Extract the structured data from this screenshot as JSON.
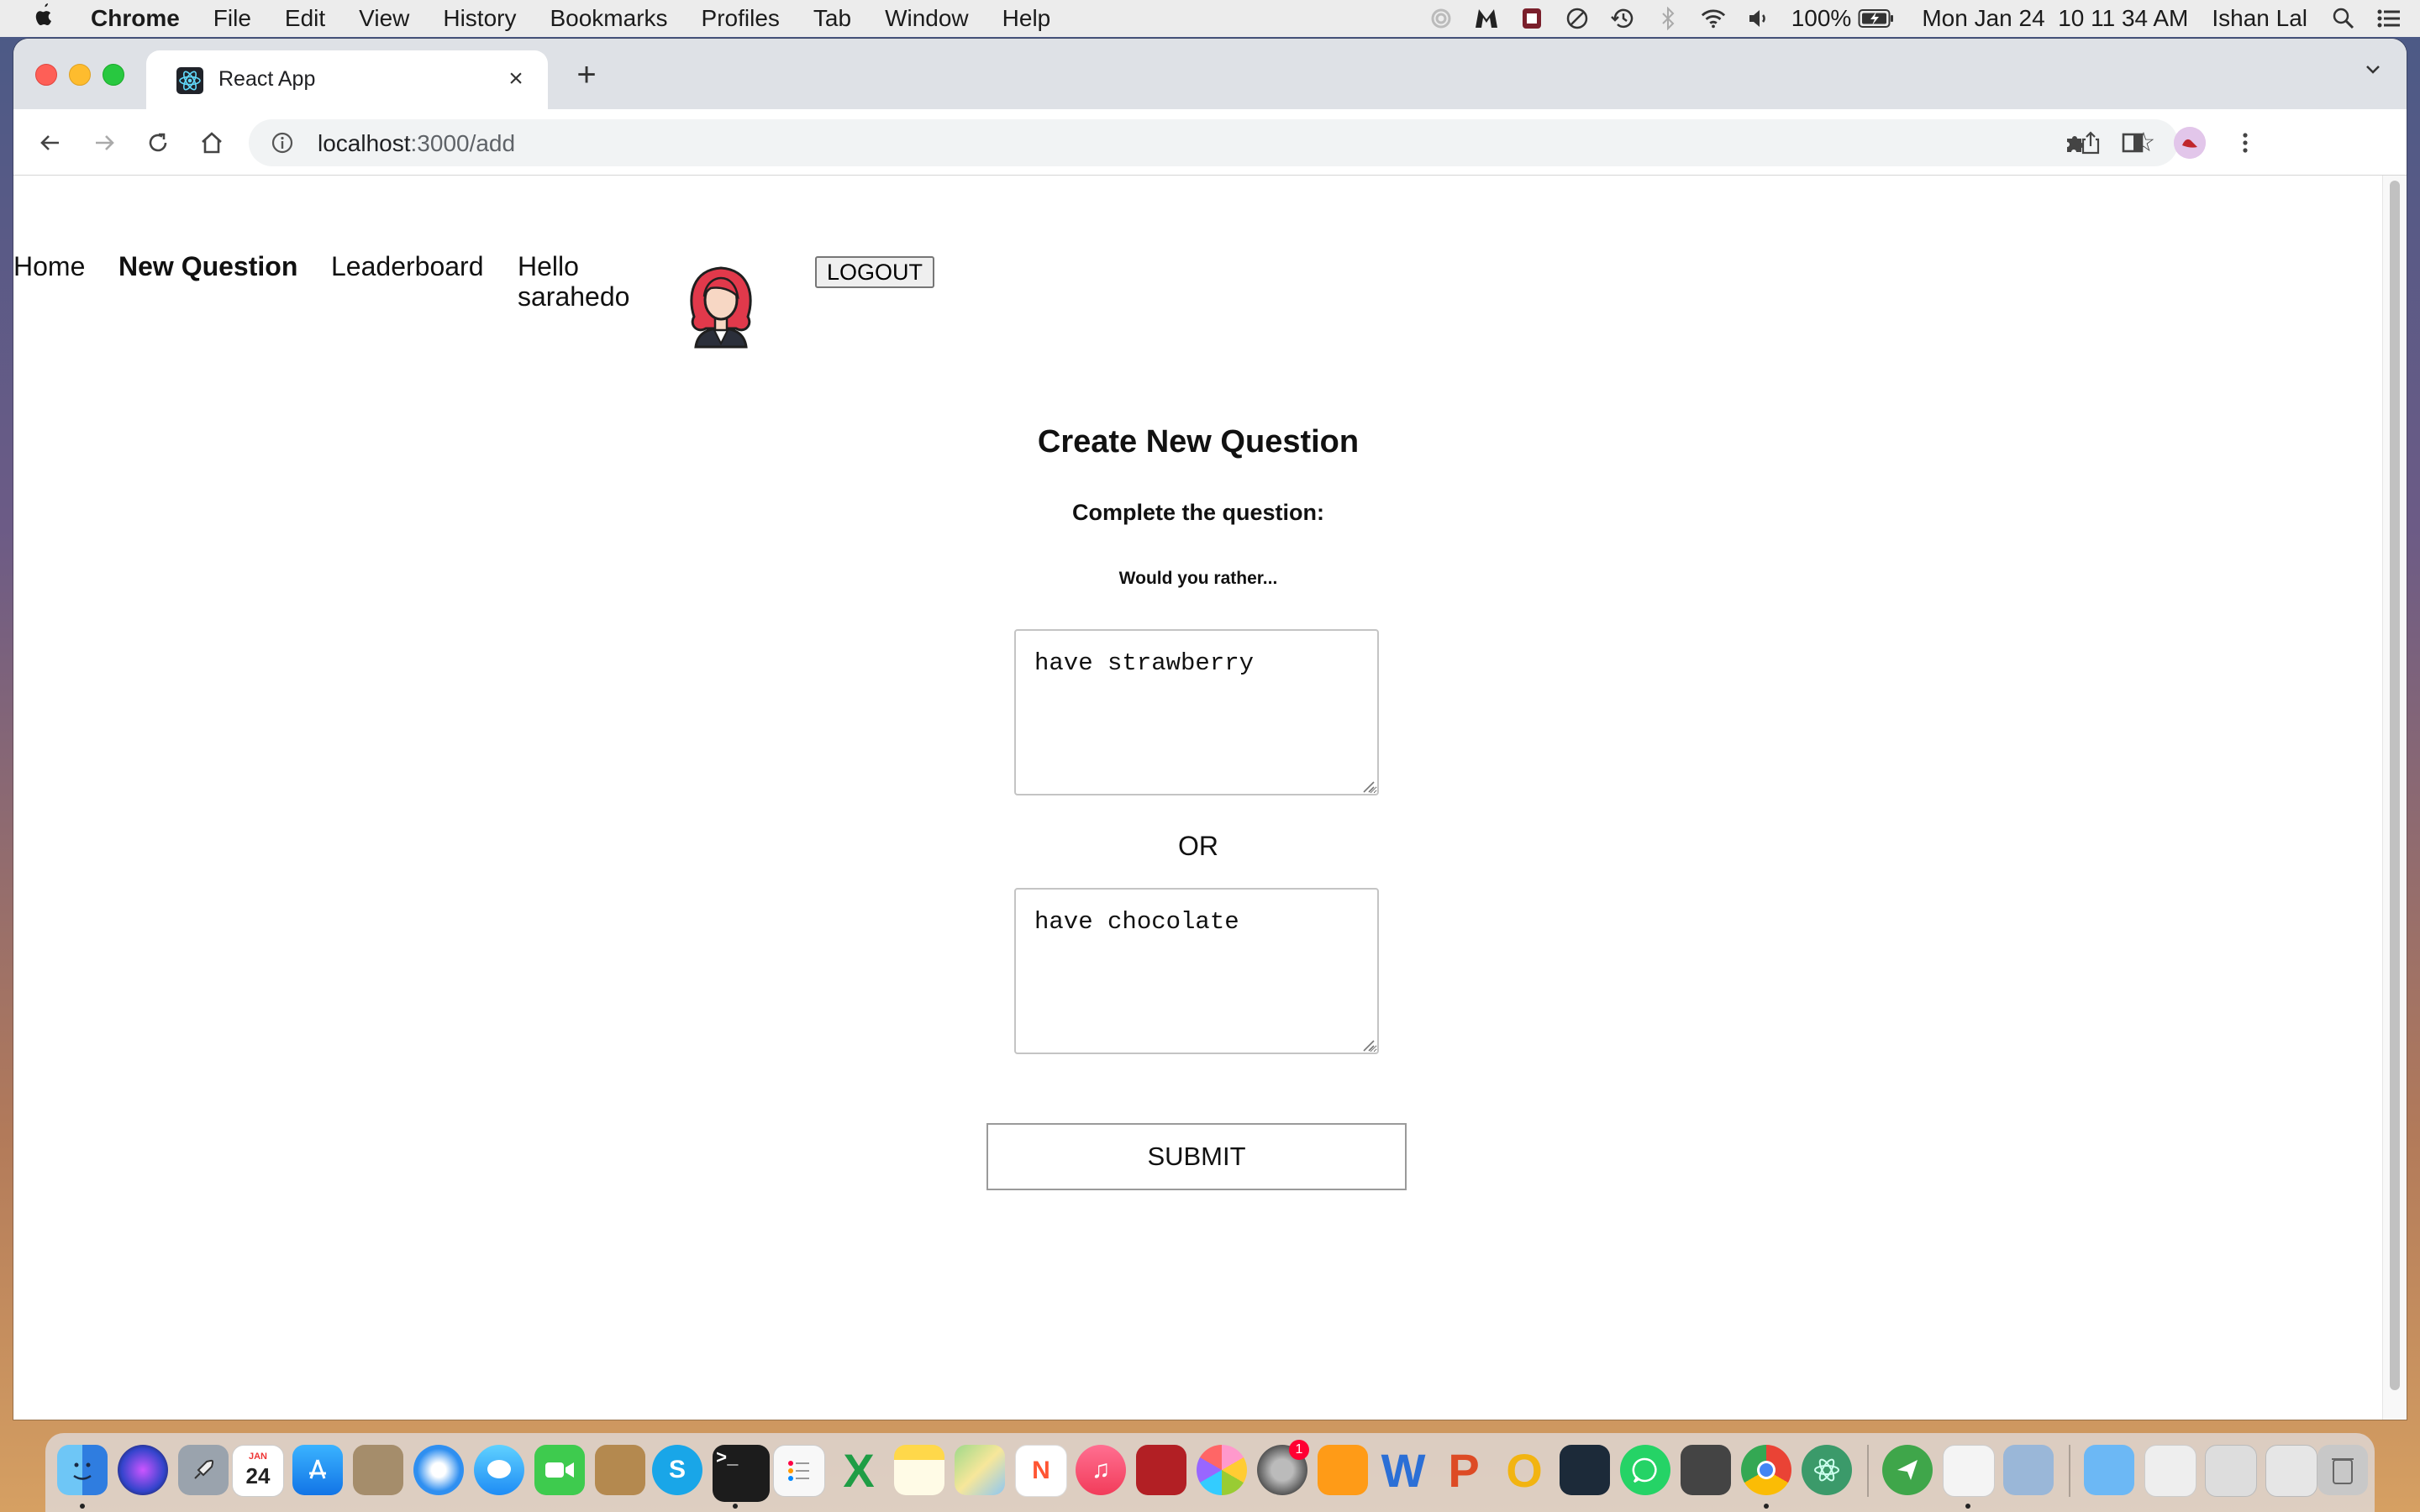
{
  "menubar": {
    "app_name": "Chrome",
    "menus": [
      "File",
      "Edit",
      "View",
      "History",
      "Bookmarks",
      "Profiles",
      "Tab",
      "Window",
      "Help"
    ],
    "status": {
      "battery_percent": "100%",
      "datetime": "Mon Jan 24  10 11 34 AM",
      "user": "Ishan Lal"
    },
    "status_icons": [
      "creative-cloud-icon",
      "malwarebytes-icon",
      "ublock-icon",
      "do-not-disturb-icon",
      "time-machine-icon",
      "bluetooth-icon",
      "wifi-icon",
      "volume-icon",
      "battery-icon",
      "spotlight-search-icon",
      "control-center-icon"
    ]
  },
  "browser": {
    "tab_title": "React App",
    "url_host": "localhost",
    "url_path": ":3000/add"
  },
  "nav": {
    "home": "Home",
    "new_question": "New Question",
    "leaderboard": "Leaderboard",
    "hello": "Hello",
    "username": "sarahedo",
    "logout": "LOGOUT"
  },
  "form": {
    "title": "Create New Question",
    "subtitle": "Complete the question:",
    "lead": "Would you rather...",
    "option_one": "have strawberry",
    "or_label": "OR",
    "option_two": "have chocolate",
    "submit": "SUBMIT"
  },
  "dock": {
    "calendar_month": "JAN",
    "calendar_day": "24",
    "badge_count": "1",
    "apps": [
      "finder",
      "siri",
      "launchpad",
      "calendar",
      "app-store",
      "preview",
      "safari",
      "messages",
      "facetime",
      "notebook",
      "skype",
      "terminal",
      "reminders",
      "excel",
      "notes",
      "maps",
      "news",
      "music",
      "photo-booth",
      "photos",
      "system-preferences",
      "books",
      "word",
      "powerpoint",
      "outlook",
      "keynote-like",
      "whatsapp",
      "calculator",
      "chrome",
      "atom",
      "telegram",
      "textedit",
      "preview-2",
      "folder",
      "documents",
      "trash"
    ]
  }
}
